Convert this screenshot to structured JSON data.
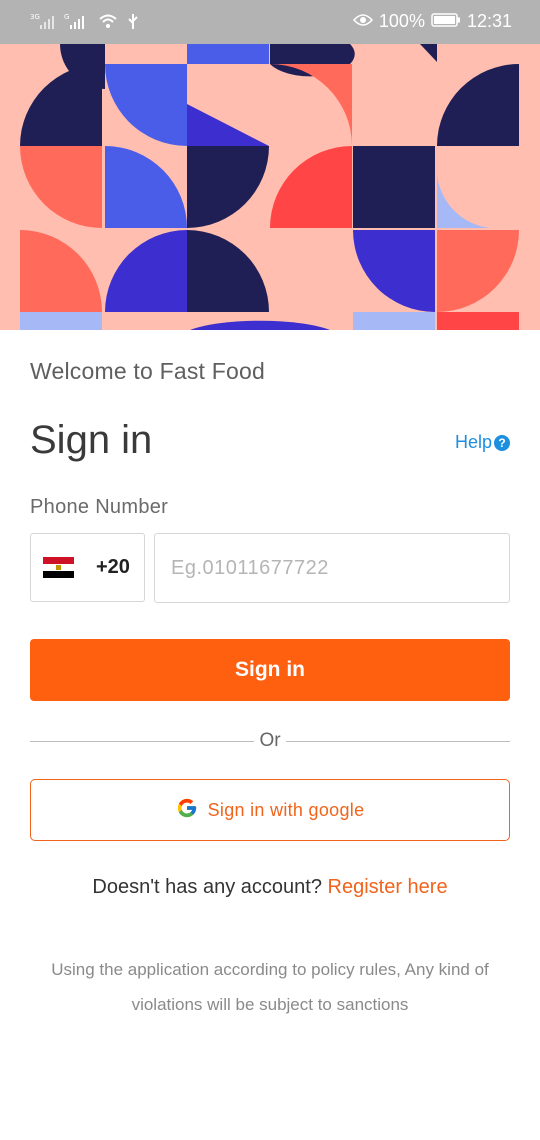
{
  "status_bar": {
    "network_1": "3G",
    "network_2": "G",
    "battery": "100%",
    "time": "12:31"
  },
  "welcome_text": "Welcome to Fast Food",
  "title": "Sign in",
  "help_label": "Help",
  "phone": {
    "label": "Phone Number",
    "country_code": "+20",
    "placeholder": "Eg.01011677722"
  },
  "signin_button": "Sign in",
  "divider_text": "Or",
  "google_button": "Sign in with google",
  "register": {
    "prompt": "Doesn't has any account?",
    "link": "Register here"
  },
  "policy_text": "Using the application according to policy rules, Any kind of violations will be subject to sanctions",
  "colors": {
    "accent": "#ff6010",
    "help_link": "#1d8fe0",
    "banner_peach": "#ffbeb0",
    "banner_navy": "#1f1f55",
    "banner_blue": "#4a5de8",
    "banner_red": "#ff5a4a"
  },
  "icons": [
    "signal-icon",
    "wifi-icon",
    "usb-icon",
    "eye-icon",
    "battery-icon",
    "help-icon",
    "egypt-flag-icon",
    "google-icon"
  ]
}
